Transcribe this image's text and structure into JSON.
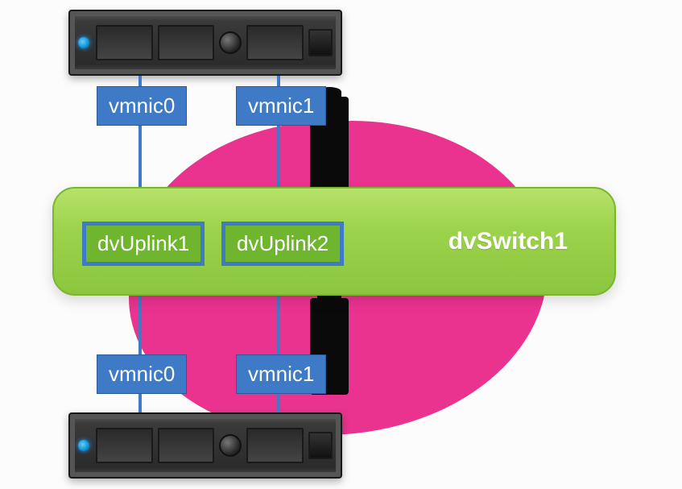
{
  "hosts": {
    "top": {
      "nics": [
        "vmnic0",
        "vmnic1"
      ]
    },
    "bottom": {
      "nics": [
        "vmnic0",
        "vmnic1"
      ]
    }
  },
  "dvswitch": {
    "name": "dvSwitch1",
    "uplinks": [
      "dvUplink1",
      "dvUplink2"
    ]
  },
  "colors": {
    "blue": "#3f7ac6",
    "green_switch": "#8cc63f",
    "uplink_fill": "#6fb52e",
    "pink": "#ea2f8d"
  }
}
